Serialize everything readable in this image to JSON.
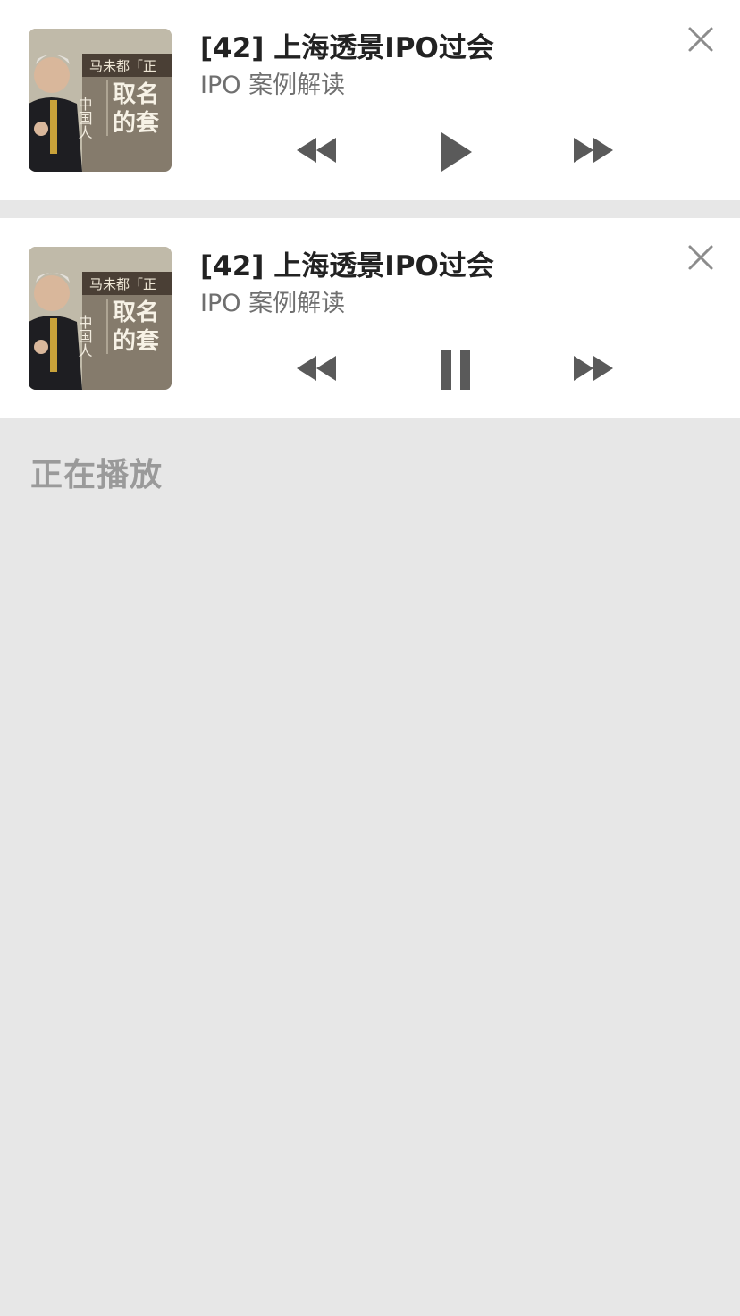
{
  "players": [
    {
      "state": "paused",
      "title": "[42] 上海透景IPO过会",
      "subtitle": "IPO 案例解读",
      "cover": {
        "line1": "马未都「正",
        "side": "中国人",
        "main1": "取名",
        "main2": "的套"
      },
      "controls": {
        "rewind_icon": "rewind-icon",
        "toggle_icon": "play-icon",
        "forward_icon": "fast-forward-icon",
        "close_icon": "close-icon"
      }
    },
    {
      "state": "playing",
      "title": "[42] 上海透景IPO过会",
      "subtitle": "IPO 案例解读",
      "cover": {
        "line1": "马未都「正",
        "side": "中国人",
        "main1": "取名",
        "main2": "的套"
      },
      "controls": {
        "rewind_icon": "rewind-icon",
        "toggle_icon": "pause-icon",
        "forward_icon": "fast-forward-icon",
        "close_icon": "close-icon"
      }
    }
  ],
  "section": {
    "label": "正在播放"
  },
  "colors": {
    "background": "#e7e7e7",
    "card": "#ffffff",
    "title": "#222222",
    "subtitle": "#6f6f6f",
    "icon": "#5a5a5a",
    "close": "#8c8c8c",
    "section_label": "#9a9a9a"
  }
}
